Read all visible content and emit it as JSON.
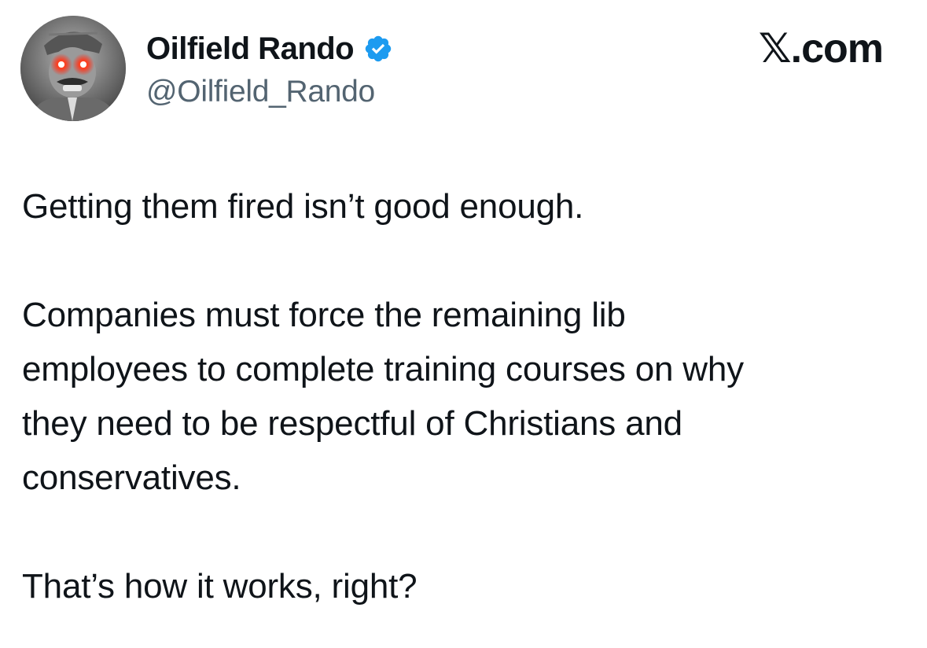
{
  "author": {
    "display_name": "Oilfield Rando",
    "handle": "@Oilfield_Rando",
    "verified": true,
    "avatar_icon": "avatar-photo-laser-eyes"
  },
  "watermark": {
    "text": "𝕏.com"
  },
  "tweet": {
    "paragraph_1": "Getting them fired isn’t good enough.",
    "paragraph_2_line_1": "Companies must force the remaining lib",
    "paragraph_2_line_2": "employees to complete training courses on why",
    "paragraph_2_line_3": "they need to be respectful of Christians and",
    "paragraph_2_line_4": "conservatives.",
    "paragraph_3": "That’s how it works, right?"
  },
  "colors": {
    "text": "#0f1419",
    "handle": "#536471",
    "verified_badge": "#1d9bf0",
    "laser_eyes": "#ff2a1a"
  }
}
